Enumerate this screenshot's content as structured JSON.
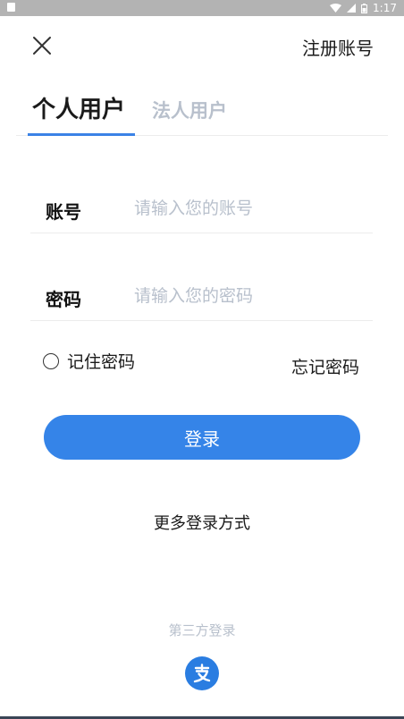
{
  "status_bar": {
    "time": "1:17"
  },
  "header": {
    "register_label": "注册账号"
  },
  "tabs": [
    {
      "label": "个人用户",
      "active": true
    },
    {
      "label": "法人用户",
      "active": false
    }
  ],
  "form": {
    "account": {
      "label": "账号",
      "value": "",
      "placeholder": "请输入您的账号"
    },
    "password": {
      "label": "密码",
      "value": "",
      "placeholder": "请输入您的密码"
    },
    "remember_label": "记住密码",
    "forgot_label": "忘记密码",
    "login_label": "登录"
  },
  "more_login_label": "更多登录方式",
  "third_party": {
    "title": "第三方登录",
    "providers": [
      {
        "icon": "alipay-icon",
        "color": "#2a7de1"
      }
    ]
  },
  "colors": {
    "accent": "#3584e8",
    "inactive_text": "#b8c0cc"
  }
}
